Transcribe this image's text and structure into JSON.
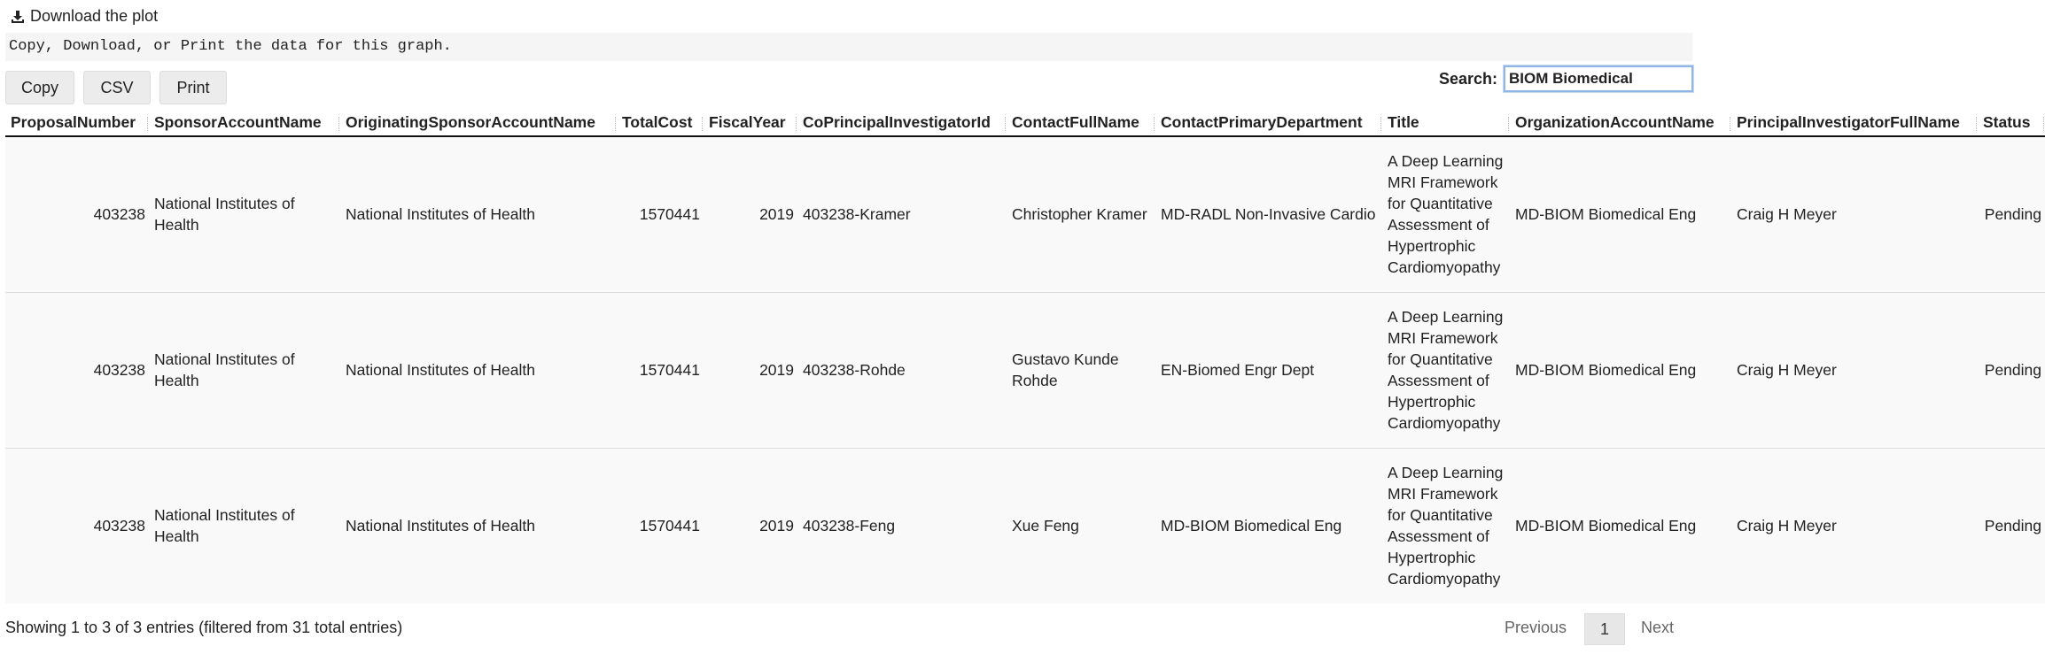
{
  "download": {
    "label": "Download the plot",
    "icon": "download-icon"
  },
  "caption": "Copy, Download, or Print the data for this graph.",
  "buttons": {
    "copy": "Copy",
    "csv": "CSV",
    "print": "Print"
  },
  "search": {
    "label": "Search:",
    "value": "BIOM Biomedical"
  },
  "table": {
    "columns": [
      "ProposalNumber",
      "SponsorAccountName",
      "OriginatingSponsorAccountName",
      "TotalCost",
      "FiscalYear",
      "CoPrincipalInvestigatorId",
      "ContactFullName",
      "ContactPrimaryDepartment",
      "Title",
      "OrganizationAccountName",
      "PrincipalInvestigatorFullName",
      "Status"
    ],
    "rows": [
      [
        "403238",
        "National Institutes of Health",
        "National Institutes of Health",
        "1570441",
        "2019",
        "403238-Kramer",
        "Christopher Kramer",
        "MD-RADL Non-Invasive Cardio",
        "A Deep Learning MRI Framework for Quantitative Assessment of Hypertrophic Cardiomyopathy",
        "MD-BIOM Biomedical Eng",
        "Craig H Meyer",
        "Pending"
      ],
      [
        "403238",
        "National Institutes of Health",
        "National Institutes of Health",
        "1570441",
        "2019",
        "403238-Rohde",
        "Gustavo Kunde Rohde",
        "EN-Biomed Engr Dept",
        "A Deep Learning MRI Framework for Quantitative Assessment of Hypertrophic Cardiomyopathy",
        "MD-BIOM Biomedical Eng",
        "Craig H Meyer",
        "Pending"
      ],
      [
        "403238",
        "National Institutes of Health",
        "National Institutes of Health",
        "1570441",
        "2019",
        "403238-Feng",
        "Xue Feng",
        "MD-BIOM Biomedical Eng",
        "A Deep Learning MRI Framework for Quantitative Assessment of Hypertrophic Cardiomyopathy",
        "MD-BIOM Biomedical Eng",
        "Craig H Meyer",
        "Pending"
      ]
    ]
  },
  "footer": {
    "info": "Showing 1 to 3 of 3 entries (filtered from 31 total entries)",
    "previous": "Previous",
    "page": "1",
    "next": "Next"
  }
}
